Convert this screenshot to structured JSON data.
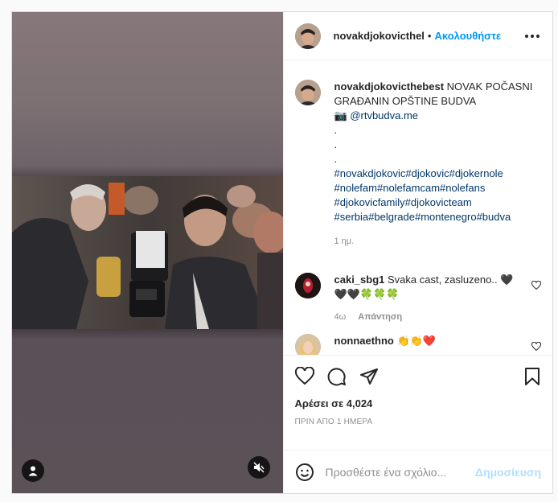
{
  "post": {
    "author": "novakdjokovicthel",
    "follow_label": "Ακολουθήστε",
    "dot": "•"
  },
  "caption": {
    "username": "novakdjokovicthebest",
    "text": "NOVAK POČASNI GRAĐANIN OPŠTINE BUDVA",
    "camera_emoji": "📷",
    "credit": "@rtvbudva.me",
    "dots": [
      ".",
      ".",
      "."
    ],
    "hashtags": "#novakdjokovic#djokovic#djokernole #nolefam#nolefamcam#nolefans #djokovicfamily#djokovicteam #serbia#belgrade#montenegro#budva",
    "age": "1 ημ."
  },
  "comments": [
    {
      "username": "caki_sbg1",
      "text": "Svaka cast, zasluzeno..",
      "emojis": "🖤 🖤🖤🍀🍀🍀",
      "age": "4ω",
      "reply_label": "Απάντηση"
    },
    {
      "username": "nonnaethno",
      "text": "",
      "emojis": "👏👏❤️"
    }
  ],
  "footer": {
    "likes": "Αρέσει σε 4,024",
    "timestamp": "ΠΡΙΝ ΑΠΟ 1 ΗΜΕΡΑ",
    "comment_placeholder": "Προσθέστε ένα σχόλιο...",
    "post_label": "Δημοσίευση"
  },
  "colors": {
    "link": "#0095f6",
    "hashtag": "#00376b",
    "muted": "#8e8e8e",
    "post_disabled": "#b2dffc"
  },
  "icons": [
    "user-tag-icon",
    "mute-icon",
    "more-icon",
    "heart-icon",
    "comment-icon",
    "share-icon",
    "save-icon",
    "emoji-icon",
    "like-comment-icon"
  ]
}
